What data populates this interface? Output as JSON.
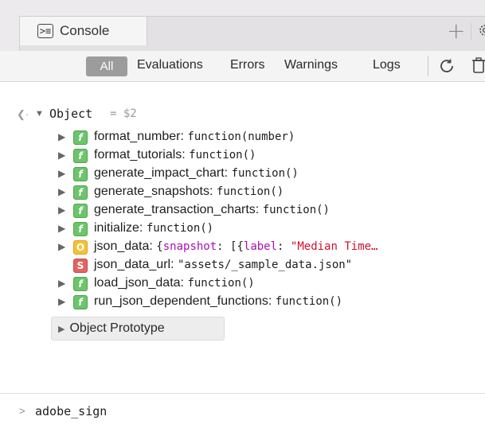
{
  "tabbar": {
    "console_label": "Console",
    "console_icon": "console-icon",
    "add_icon": "plus-icon",
    "settings_icon": "gear-icon"
  },
  "filters": {
    "items": [
      "All",
      "Evaluations",
      "Errors",
      "Warnings",
      "Logs"
    ],
    "active": "All",
    "reload_icon": "reload-icon",
    "clear_icon": "trash-icon"
  },
  "object": {
    "name": "Object",
    "equals": "=",
    "ref": "$2"
  },
  "properties": [
    {
      "type": "f",
      "name": "format_number:",
      "value": "function(number)"
    },
    {
      "type": "f",
      "name": "format_tutorials:",
      "value": "function()"
    },
    {
      "type": "f",
      "name": "generate_impact_chart:",
      "value": "function()"
    },
    {
      "type": "f",
      "name": "generate_snapshots:",
      "value": "function()"
    },
    {
      "type": "f",
      "name": "generate_transaction_charts:",
      "value": "function()"
    },
    {
      "type": "f",
      "name": "initialize:",
      "value": "function()"
    },
    {
      "type": "O",
      "name": "json_data:",
      "value_parts": [
        "{",
        "snapshot",
        ": [{",
        "label",
        ": ",
        "\"Median Time…"
      ]
    },
    {
      "type": "S",
      "name": "json_data_url:",
      "value": "\"assets/_sample_data.json\""
    },
    {
      "type": "f",
      "name": "load_json_data:",
      "value": "function()"
    },
    {
      "type": "f",
      "name": "run_json_dependent_functions:",
      "value": "function()"
    }
  ],
  "prototype_label": "Object Prototype",
  "prompt": {
    "symbol": ">",
    "text": "adobe_sign"
  },
  "colors": {
    "function_badge": "#6dc56b",
    "object_badge": "#f5c236",
    "string_badge": "#e26460",
    "keyword": "#aa0fb6",
    "string": "#d0102c"
  }
}
